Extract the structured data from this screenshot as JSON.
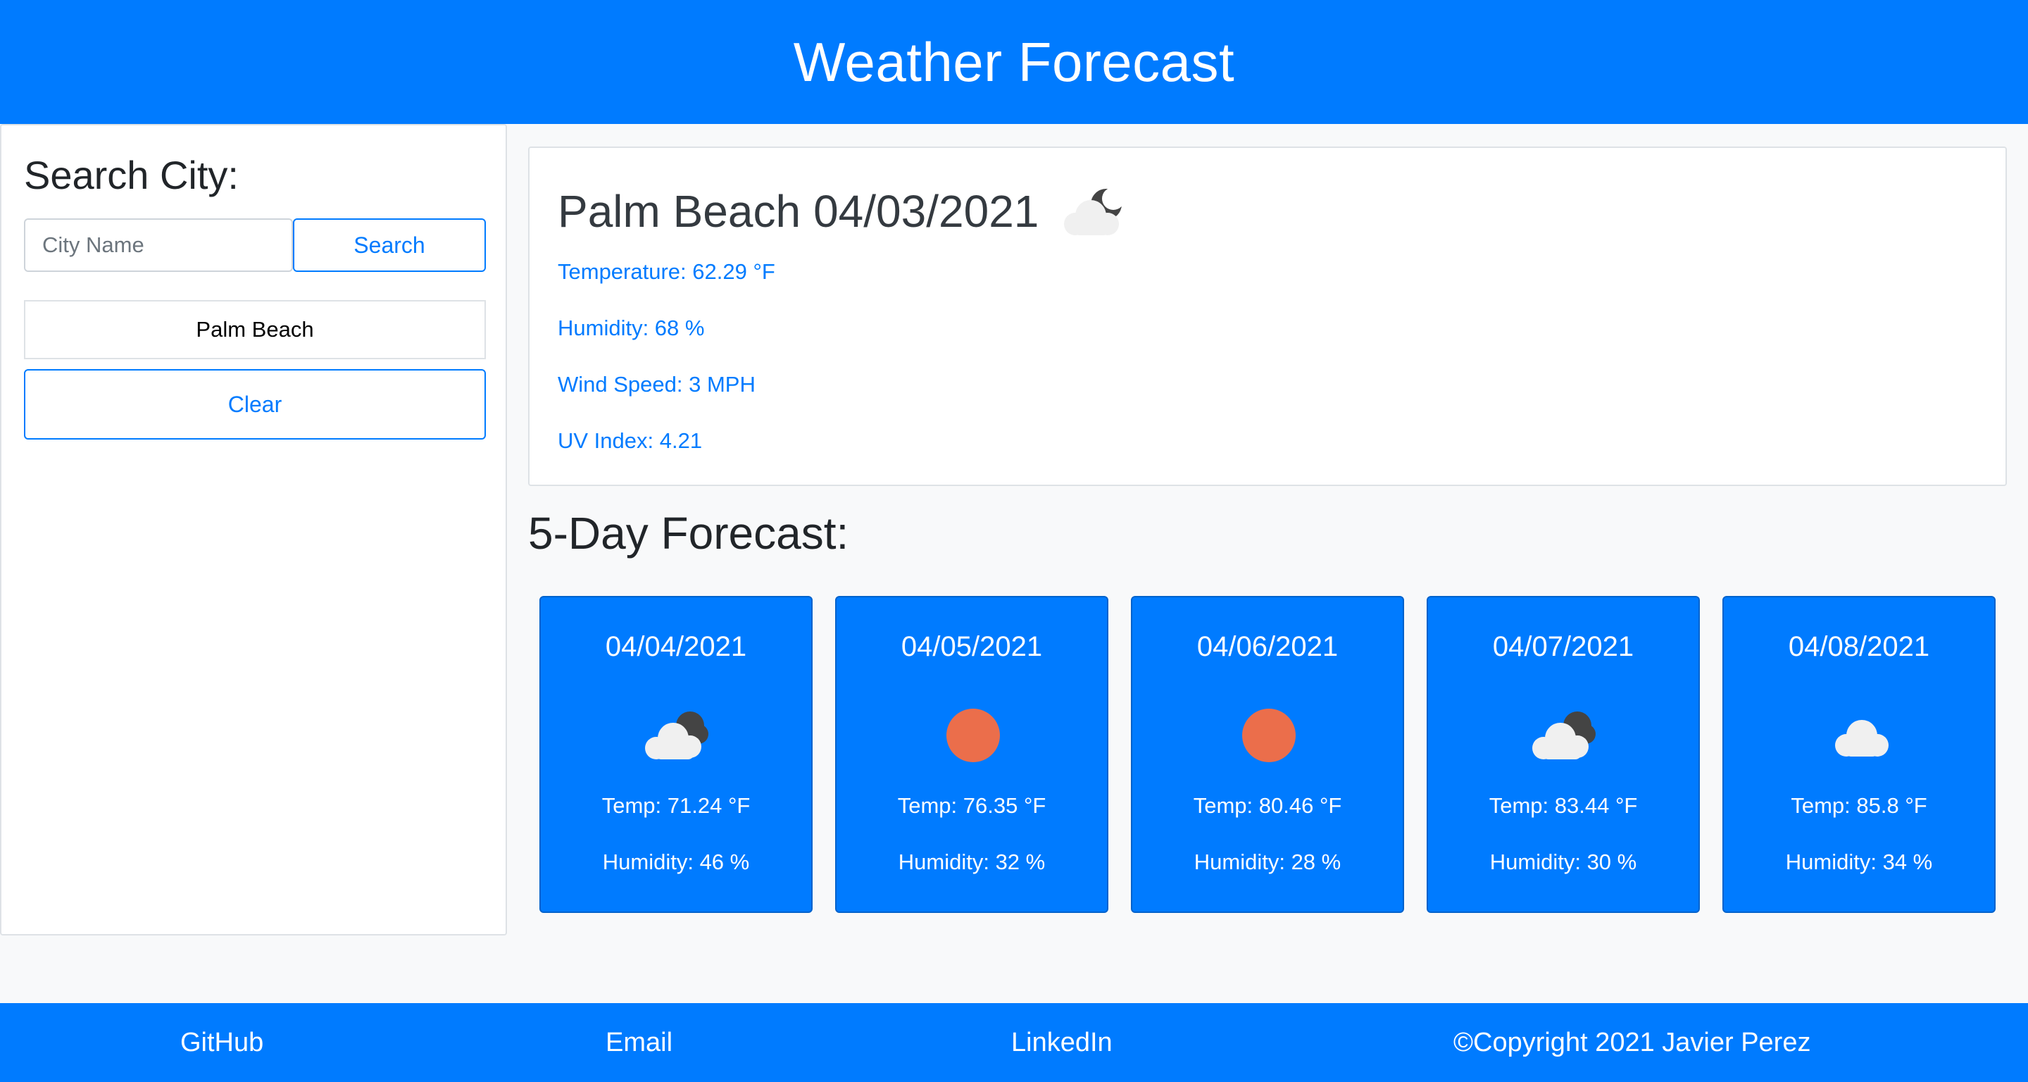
{
  "header": {
    "title": "Weather Forecast"
  },
  "sidebar": {
    "heading": "Search City:",
    "search_placeholder": "City Name",
    "search_label": "Search",
    "history": [
      "Palm Beach"
    ],
    "clear_label": "Clear"
  },
  "current": {
    "city": "Palm Beach",
    "date": "04/03/2021",
    "icon": "cloud-moon-icon",
    "temperature": "Temperature: 62.29 °F",
    "humidity": "Humidity: 68 %",
    "wind": "Wind Speed: 3 MPH",
    "uv": "UV Index: 4.21"
  },
  "forecast": {
    "heading": "5-Day Forecast:",
    "days": [
      {
        "date": "04/04/2021",
        "icon": "cloud-moon-icon",
        "temp": "Temp: 71.24 °F",
        "humidity": "Humidity: 46 %"
      },
      {
        "date": "04/05/2021",
        "icon": "sun-icon",
        "temp": "Temp: 76.35 °F",
        "humidity": "Humidity: 32 %"
      },
      {
        "date": "04/06/2021",
        "icon": "sun-icon",
        "temp": "Temp: 80.46 °F",
        "humidity": "Humidity: 28 %"
      },
      {
        "date": "04/07/2021",
        "icon": "cloud-moon-icon",
        "temp": "Temp: 83.44 °F",
        "humidity": "Humidity: 30 %"
      },
      {
        "date": "04/08/2021",
        "icon": "cloud-icon",
        "temp": "Temp: 85.8 °F",
        "humidity": "Humidity: 34 %"
      }
    ]
  },
  "footer": {
    "github": "GitHub",
    "email": "Email",
    "linkedin": "LinkedIn",
    "copyright": "©Copyright 2021 Javier Perez"
  },
  "colors": {
    "primary": "#007bff",
    "sun": "#eb6e4b",
    "cloud": "#f0f0f0",
    "moon_dark": "#444444"
  }
}
